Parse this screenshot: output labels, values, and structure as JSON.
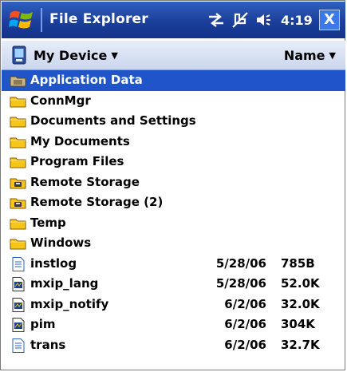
{
  "titlebar": {
    "app_title": "File Explorer",
    "clock": "4:19",
    "close_label": "X",
    "colors": {
      "bar": "#1b3f9a",
      "close_button": "#3c78e6"
    }
  },
  "locationbar": {
    "location": "My Device",
    "sort_by": "Name"
  },
  "items": [
    {
      "name": "Application Data",
      "type": "folder-system",
      "date": "",
      "size": "",
      "selected": true
    },
    {
      "name": "ConnMgr",
      "type": "folder",
      "date": "",
      "size": ""
    },
    {
      "name": "Documents and Settings",
      "type": "folder",
      "date": "",
      "size": ""
    },
    {
      "name": "My Documents",
      "type": "folder",
      "date": "",
      "size": ""
    },
    {
      "name": "Program Files",
      "type": "folder",
      "date": "",
      "size": ""
    },
    {
      "name": "Remote Storage",
      "type": "folder-storage",
      "date": "",
      "size": ""
    },
    {
      "name": "Remote Storage (2)",
      "type": "folder-storage",
      "date": "",
      "size": ""
    },
    {
      "name": "Temp",
      "type": "folder",
      "date": "",
      "size": ""
    },
    {
      "name": "Windows",
      "type": "folder",
      "date": "",
      "size": ""
    },
    {
      "name": "instlog",
      "type": "file-text",
      "date": "5/28/06",
      "size": "785B"
    },
    {
      "name": "mxip_lang",
      "type": "file-app",
      "date": "5/28/06",
      "size": "52.0K"
    },
    {
      "name": "mxip_notify",
      "type": "file-app",
      "date": "6/2/06",
      "size": "32.0K"
    },
    {
      "name": "pim",
      "type": "file-app",
      "date": "6/2/06",
      "size": "304K"
    },
    {
      "name": "trans",
      "type": "file-text",
      "date": "6/2/06",
      "size": "32.7K"
    }
  ],
  "colors": {
    "selection": "#1f55c9",
    "folder": "#f5c518"
  }
}
